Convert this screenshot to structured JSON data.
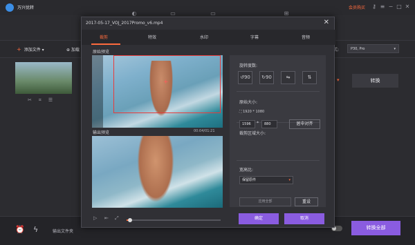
{
  "app": {
    "title": "万兴优转",
    "buy_label": "会员购买"
  },
  "subbar": {
    "add_file": "添加文件",
    "add_file_2": "加载",
    "format_label": "式:",
    "format_value": "P30, Pro"
  },
  "main": {
    "convert_label": "转换"
  },
  "bottombar": {
    "output_folder": "输出文件夹",
    "convert_all": "转换全部"
  },
  "dialog": {
    "title": "2017-05-17_VOJ_2017Promo_v6.mp4",
    "tabs": [
      "裁剪",
      "特效",
      "水印",
      "字幕",
      "音频"
    ],
    "original_preview": "原始预览",
    "output_preview": "输出预览",
    "time": "00:04/01:21",
    "progress_pct": 4,
    "rotate_label": "旋转度数:",
    "rotate_buttons": [
      "↺90",
      "↻90",
      "⇋",
      "⇅"
    ],
    "original_size_label": "原始大小:",
    "original_size_value": "1920 * 1080",
    "crop_size_label": "裁剪区域大小:",
    "crop_w": "1596",
    "crop_x": "*",
    "crop_h": "880",
    "center_btn": "居中对齐",
    "aspect_label": "宽高比:",
    "aspect_value": "保留原件",
    "apply_all": "应用全部",
    "reset": "重设",
    "ok": "确定",
    "cancel": "取消"
  }
}
